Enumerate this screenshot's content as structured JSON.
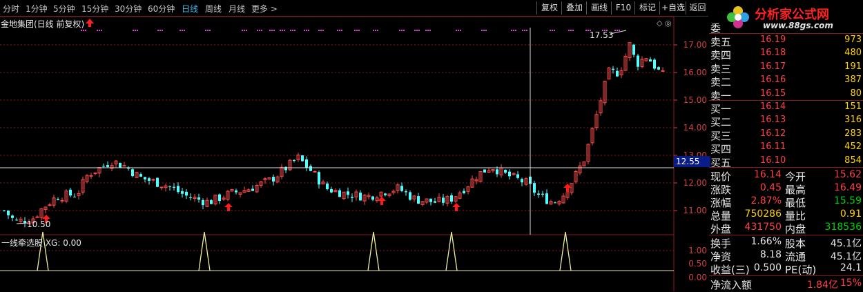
{
  "toolbar": {
    "timeframes": [
      "分时",
      "1分钟",
      "5分钟",
      "15分钟",
      "30分钟",
      "60分钟",
      "日线",
      "周线",
      "月线",
      "更多 >"
    ],
    "active_timeframe": "日线",
    "buttons": [
      "复权",
      "叠加",
      "画线",
      "F10",
      "标记",
      "+自选",
      "返回"
    ]
  },
  "chart": {
    "title": "金地集团(日线 前复权)",
    "high_marker": "17.53",
    "low_marker": "10.50",
    "current_price_label": "12.55",
    "price_axis": [
      "17.00",
      "16.00",
      "15.00",
      "14.00",
      "13.00",
      "12.00",
      "11.00"
    ],
    "indicator_label": "一线牵选股 XG: 0.00",
    "indicator_axis": [
      "1.00",
      "0.50",
      "0.00"
    ]
  },
  "chart_data": {
    "type": "candlestick",
    "price_range": [
      10.5,
      17.53
    ],
    "high": 17.53,
    "low": 10.5,
    "indicator": "XG",
    "indicator_value": 0.0
  },
  "logo": {
    "text": "分析家公式网",
    "url": "www.88gs.com"
  },
  "orderbook": {
    "header": "委",
    "asks": [
      {
        "label": "卖五",
        "price": "16.19",
        "vol": "973"
      },
      {
        "label": "卖四",
        "price": "16.18",
        "vol": "480"
      },
      {
        "label": "卖三",
        "price": "16.17",
        "vol": "191"
      },
      {
        "label": "卖二",
        "price": "16.16",
        "vol": "387"
      },
      {
        "label": "卖一",
        "price": "16.15",
        "vol": "80"
      }
    ],
    "bids": [
      {
        "label": "买一",
        "price": "16.14",
        "vol": "151"
      },
      {
        "label": "买二",
        "price": "16.13",
        "vol": "316"
      },
      {
        "label": "买三",
        "price": "16.12",
        "vol": "283"
      },
      {
        "label": "买四",
        "price": "16.11",
        "vol": "452"
      },
      {
        "label": "买五",
        "price": "16.10",
        "vol": "854"
      }
    ]
  },
  "stats": {
    "xianjia_label": "现价",
    "xianjia": "16.14",
    "jinkai_label": "今开",
    "jinkai": "15.62",
    "zhangdie_label": "涨跌",
    "zhangdie": "0.45",
    "zuigao_label": "最高",
    "zuigao": "16.49",
    "zhangfu_label": "涨幅",
    "zhangfu": "2.87%",
    "zuidi_label": "最低",
    "zuidi": "15.59",
    "zongliang_label": "总量",
    "zongliang": "750286",
    "liangbi_label": "量比",
    "liangbi": "0.91",
    "waipan_label": "外盘",
    "waipan": "431750",
    "neipan_label": "内盘",
    "neipan": "318536",
    "huanshou_label": "换手",
    "huanshou": "1.66%",
    "guben_label": "股本",
    "guben": "45.1亿",
    "jingzi_label": "净资",
    "jingzi": "8.18",
    "liutong_label": "流通",
    "liutong": "45.1亿",
    "shouyi_label": "收益(三)",
    "shouyi": "0.500",
    "pe_label": "PE(动)",
    "pe": "24.1",
    "jingliuru_label": "净流入额",
    "jingliuru": "1.84亿",
    "jingliuru_pct": "15%"
  }
}
